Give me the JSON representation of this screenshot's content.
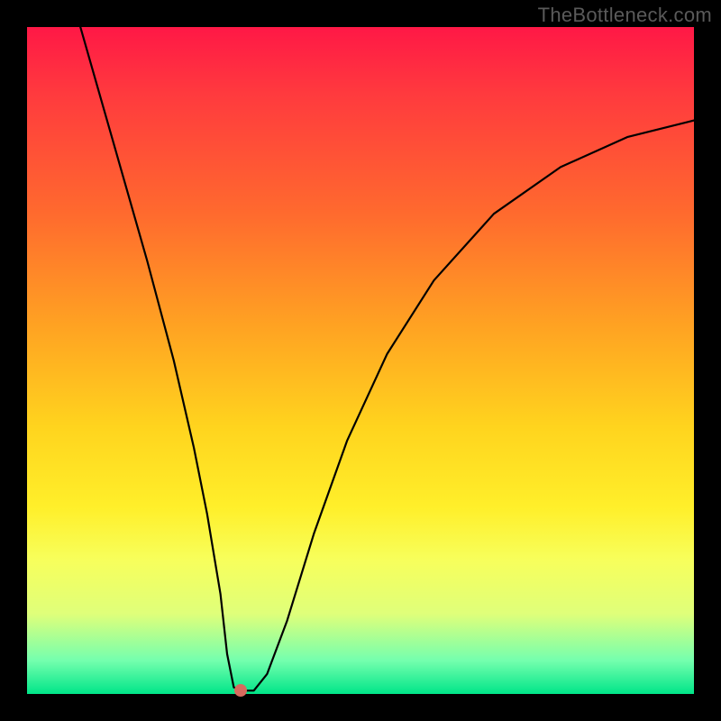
{
  "watermark": "TheBottleneck.com",
  "chart_data": {
    "type": "line",
    "title": "",
    "xlabel": "",
    "ylabel": "",
    "xlim": [
      0,
      100
    ],
    "ylim": [
      0,
      100
    ],
    "series": [
      {
        "name": "curve",
        "x": [
          8,
          10,
          14,
          18,
          22,
          25,
          27,
          29,
          30,
          31,
          32,
          34,
          36,
          39,
          43,
          48,
          54,
          61,
          70,
          80,
          90,
          100
        ],
        "values": [
          100,
          93,
          79,
          65,
          50,
          37,
          27,
          15,
          6,
          1,
          0.5,
          0.5,
          3,
          11,
          24,
          38,
          51,
          62,
          72,
          79,
          83.5,
          86
        ]
      }
    ],
    "marker": {
      "x": 32,
      "y": 0.5
    },
    "background_gradient": {
      "top": "#ff1846",
      "mid": "#ffd41e",
      "bottom": "#00e589"
    },
    "frame_color": "#000000"
  }
}
